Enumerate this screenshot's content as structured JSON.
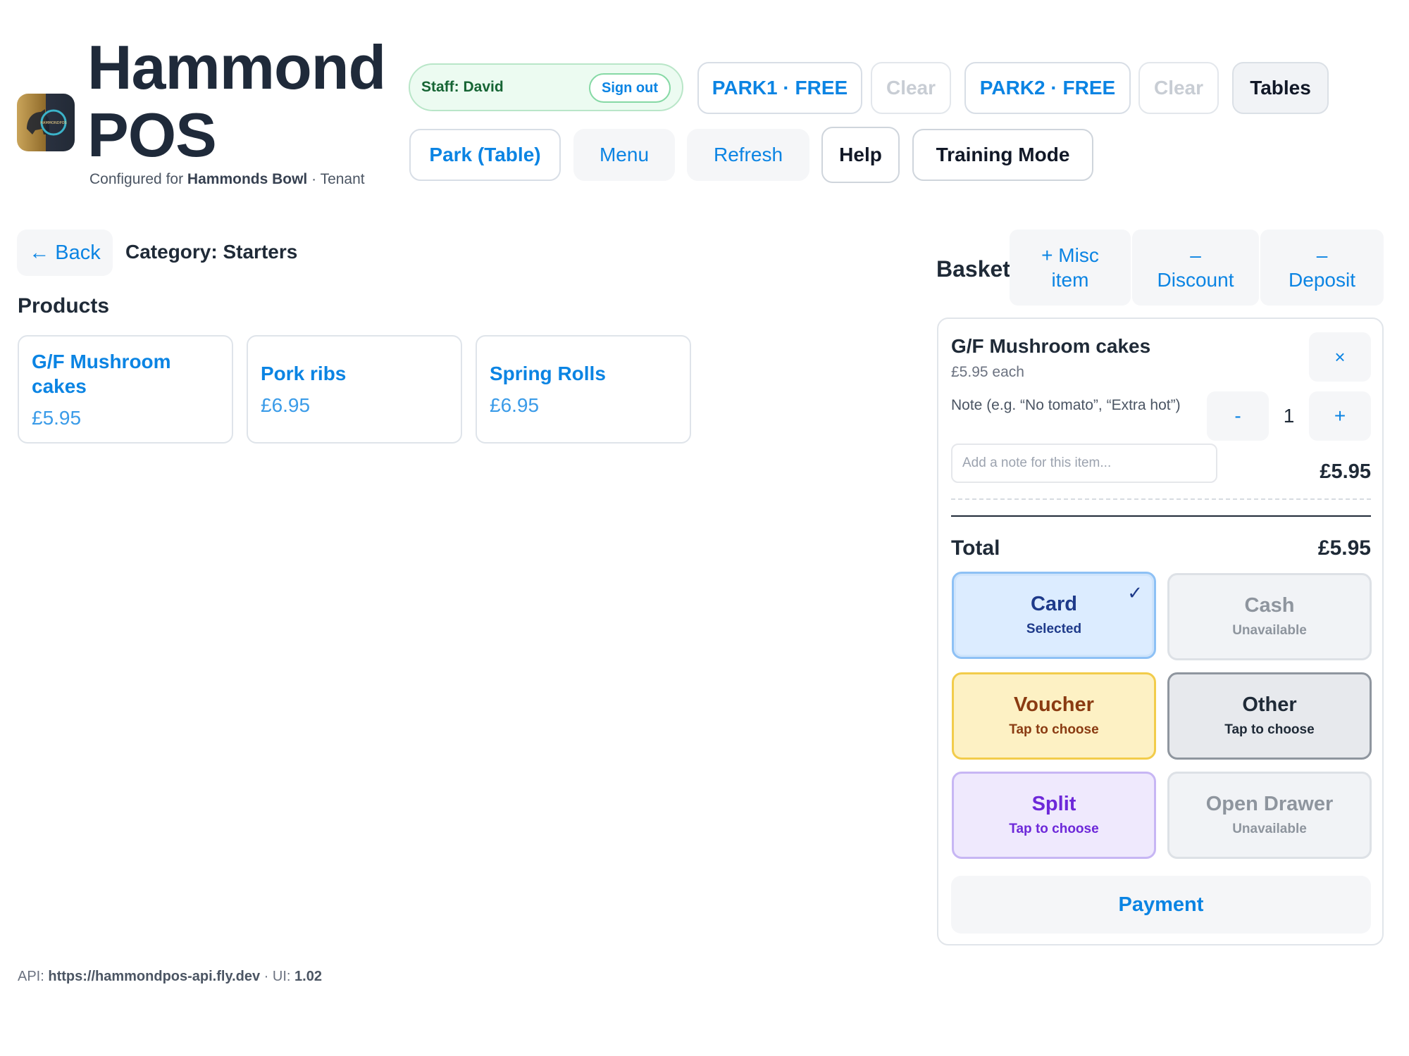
{
  "header": {
    "title": "Hammond POS",
    "configured_prefix": "Configured for",
    "tenant_name": "Hammonds Bowl",
    "configured_suffix": " · Tenant",
    "logo_text": "HAMMONDPOS"
  },
  "staff": {
    "label": "Staff: David",
    "sign_out": "Sign out"
  },
  "toolbar": {
    "park1": "PARK1 · FREE",
    "clear1": "Clear",
    "park2": "PARK2 · FREE",
    "clear2": "Clear",
    "tables": "Tables",
    "park_table": "Park (Table)",
    "menu": "Menu",
    "refresh": "Refresh",
    "help": "Help",
    "training": "Training Mode"
  },
  "catalog": {
    "back": "← Back",
    "category": "Category: Starters",
    "products_heading": "Products",
    "products": [
      {
        "name": "G/F Mushroom cakes",
        "price": "£5.95"
      },
      {
        "name": "Pork ribs",
        "price": "£6.95"
      },
      {
        "name": "Spring Rolls",
        "price": "£6.95"
      }
    ]
  },
  "basket": {
    "title": "Basket",
    "actions": {
      "misc": "+ Misc item",
      "discount_sign": "–",
      "discount": "Discount",
      "deposit_sign": "–",
      "deposit": "Deposit"
    },
    "item": {
      "name": "G/F Mushroom cakes",
      "each": "£5.95 each",
      "remove": "×",
      "note_label": "Note (e.g. “No tomato”, “Extra hot”)",
      "note_placeholder": "Add a note for this item...",
      "note_value": "",
      "qty_minus": "-",
      "qty": "1",
      "qty_plus": "+",
      "line_total": "£5.95"
    },
    "total_label": "Total",
    "total_value": "£5.95",
    "tenders": {
      "card": {
        "name": "Card",
        "sub": "Selected",
        "check": "✓"
      },
      "cash": {
        "name": "Cash",
        "sub": "Unavailable"
      },
      "voucher": {
        "name": "Voucher",
        "sub": "Tap to choose"
      },
      "other": {
        "name": "Other",
        "sub": "Tap to choose"
      },
      "split": {
        "name": "Split",
        "sub": "Tap to choose"
      },
      "drawer": {
        "name": "Open Drawer",
        "sub": "Unavailable"
      }
    },
    "payment": "Payment"
  },
  "footer": {
    "api_label": "API:",
    "api_url": "https://hammondpos-api.fly.dev",
    "ui_label": " · UI:",
    "ui_version": "1.02"
  },
  "colors": {
    "accent": "#0b84e3",
    "card_selected": "#dcecff",
    "voucher": "#fdf1c4",
    "split": "#efe9fd"
  }
}
